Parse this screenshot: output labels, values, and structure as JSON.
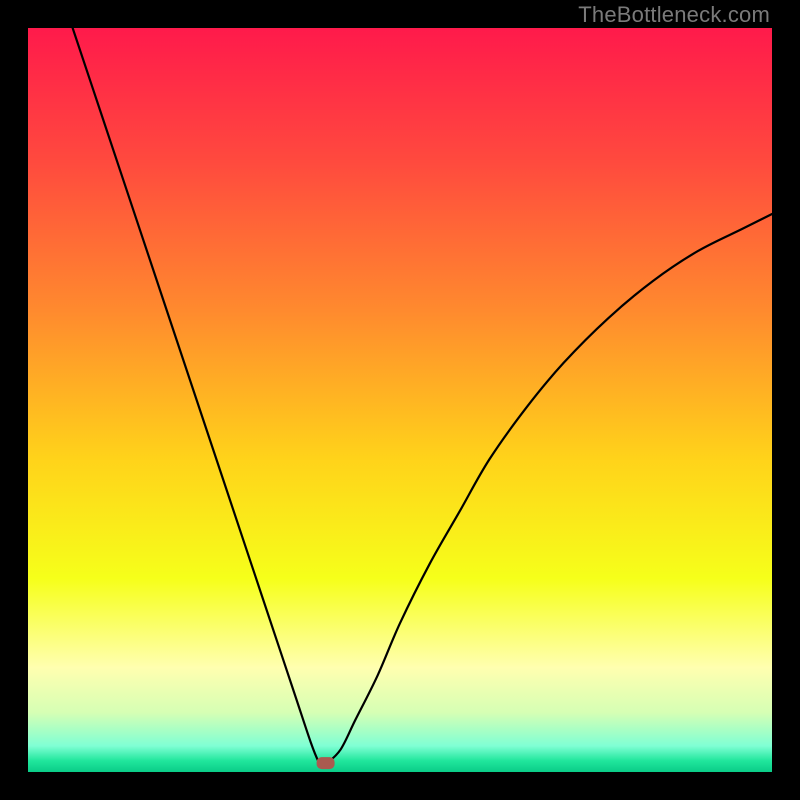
{
  "watermark": "TheBottleneck.com",
  "chart_data": {
    "type": "line",
    "title": "",
    "xlabel": "",
    "ylabel": "",
    "xlim": [
      0,
      100
    ],
    "ylim": [
      0,
      100
    ],
    "grid": false,
    "legend": false,
    "series": [
      {
        "name": "left-bottleneck-curve",
        "x": [
          6,
          10,
          14,
          18,
          22,
          26,
          30,
          34,
          36,
          38,
          39,
          39.5
        ],
        "y": [
          100,
          88,
          76,
          64,
          52,
          40,
          28,
          16,
          10,
          4,
          1.5,
          1
        ]
      },
      {
        "name": "right-bottleneck-curve",
        "x": [
          40,
          42,
          44,
          47,
          50,
          54,
          58,
          62,
          67,
          72,
          78,
          84,
          90,
          96,
          100
        ],
        "y": [
          1,
          3,
          7,
          13,
          20,
          28,
          35,
          42,
          49,
          55,
          61,
          66,
          70,
          73,
          75
        ]
      }
    ],
    "marker": {
      "name": "sweet-spot-marker",
      "x": 40,
      "y": 1.2,
      "color": "#aa5a4f"
    },
    "gradient_stops": [
      {
        "offset": 0.0,
        "color": "#ff1a4b"
      },
      {
        "offset": 0.18,
        "color": "#ff4a3e"
      },
      {
        "offset": 0.38,
        "color": "#ff8a2e"
      },
      {
        "offset": 0.58,
        "color": "#ffd31a"
      },
      {
        "offset": 0.74,
        "color": "#f6ff1a"
      },
      {
        "offset": 0.86,
        "color": "#ffffb0"
      },
      {
        "offset": 0.92,
        "color": "#d6ffb4"
      },
      {
        "offset": 0.965,
        "color": "#7fffd4"
      },
      {
        "offset": 0.985,
        "color": "#20e69c"
      },
      {
        "offset": 1.0,
        "color": "#0acc88"
      }
    ]
  }
}
